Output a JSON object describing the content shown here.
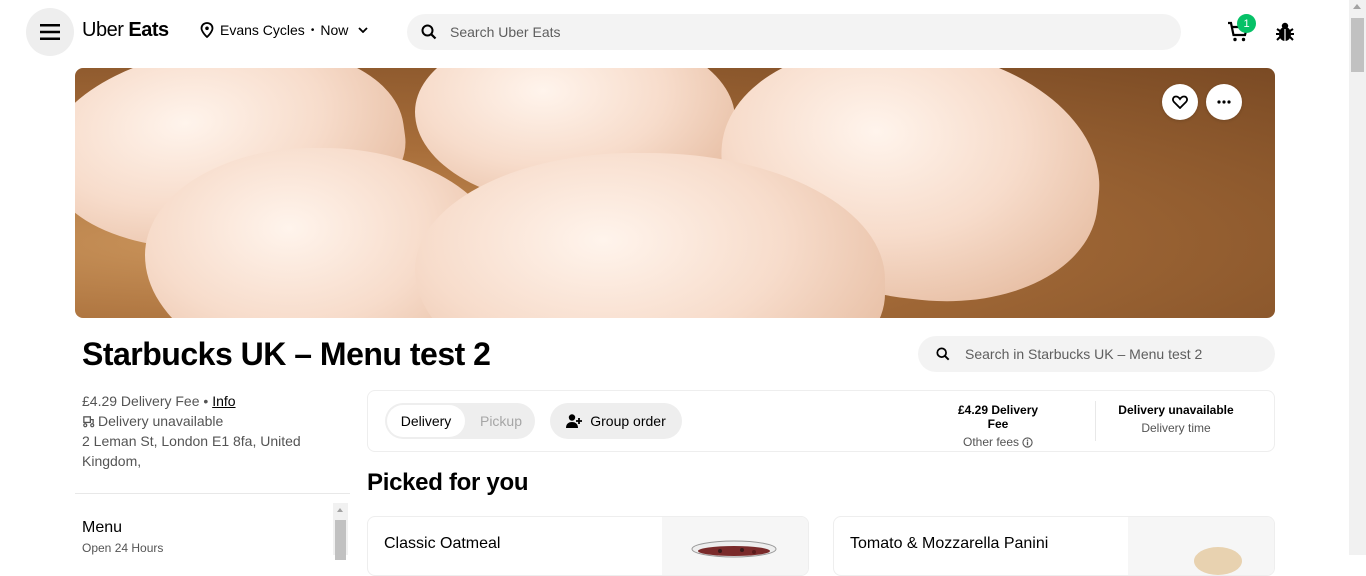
{
  "header": {
    "logo_light": "Uber",
    "logo_bold": "Eats",
    "location": "Evans Cycles",
    "time": "Now",
    "search_placeholder": "Search Uber Eats",
    "cart_count": "1"
  },
  "store": {
    "title": "Starbucks UK – Menu test 2",
    "search_placeholder": "Search in Starbucks UK – Menu test 2",
    "fee_line": "£4.29 Delivery Fee •",
    "info_link": "Info",
    "delivery_status": "Delivery unavailable",
    "address": "2 Leman St, London E1 8fa, United Kingdom,"
  },
  "sidebar": {
    "menu_title": "Menu",
    "menu_hours": "Open 24 Hours"
  },
  "order": {
    "delivery_label": "Delivery",
    "pickup_label": "Pickup",
    "group_label": "Group order",
    "fee_title": "£4.29 Delivery Fee",
    "fee_sub": "Other fees",
    "time_title": "Delivery unavailable",
    "time_sub": "Delivery time"
  },
  "picked": {
    "title": "Picked for you",
    "items": [
      {
        "name": "Classic Oatmeal"
      },
      {
        "name": "Tomato & Mozzarella Panini"
      }
    ]
  },
  "colors": {
    "accent_green": "#06c167",
    "chip_bg": "#eeeeee"
  }
}
